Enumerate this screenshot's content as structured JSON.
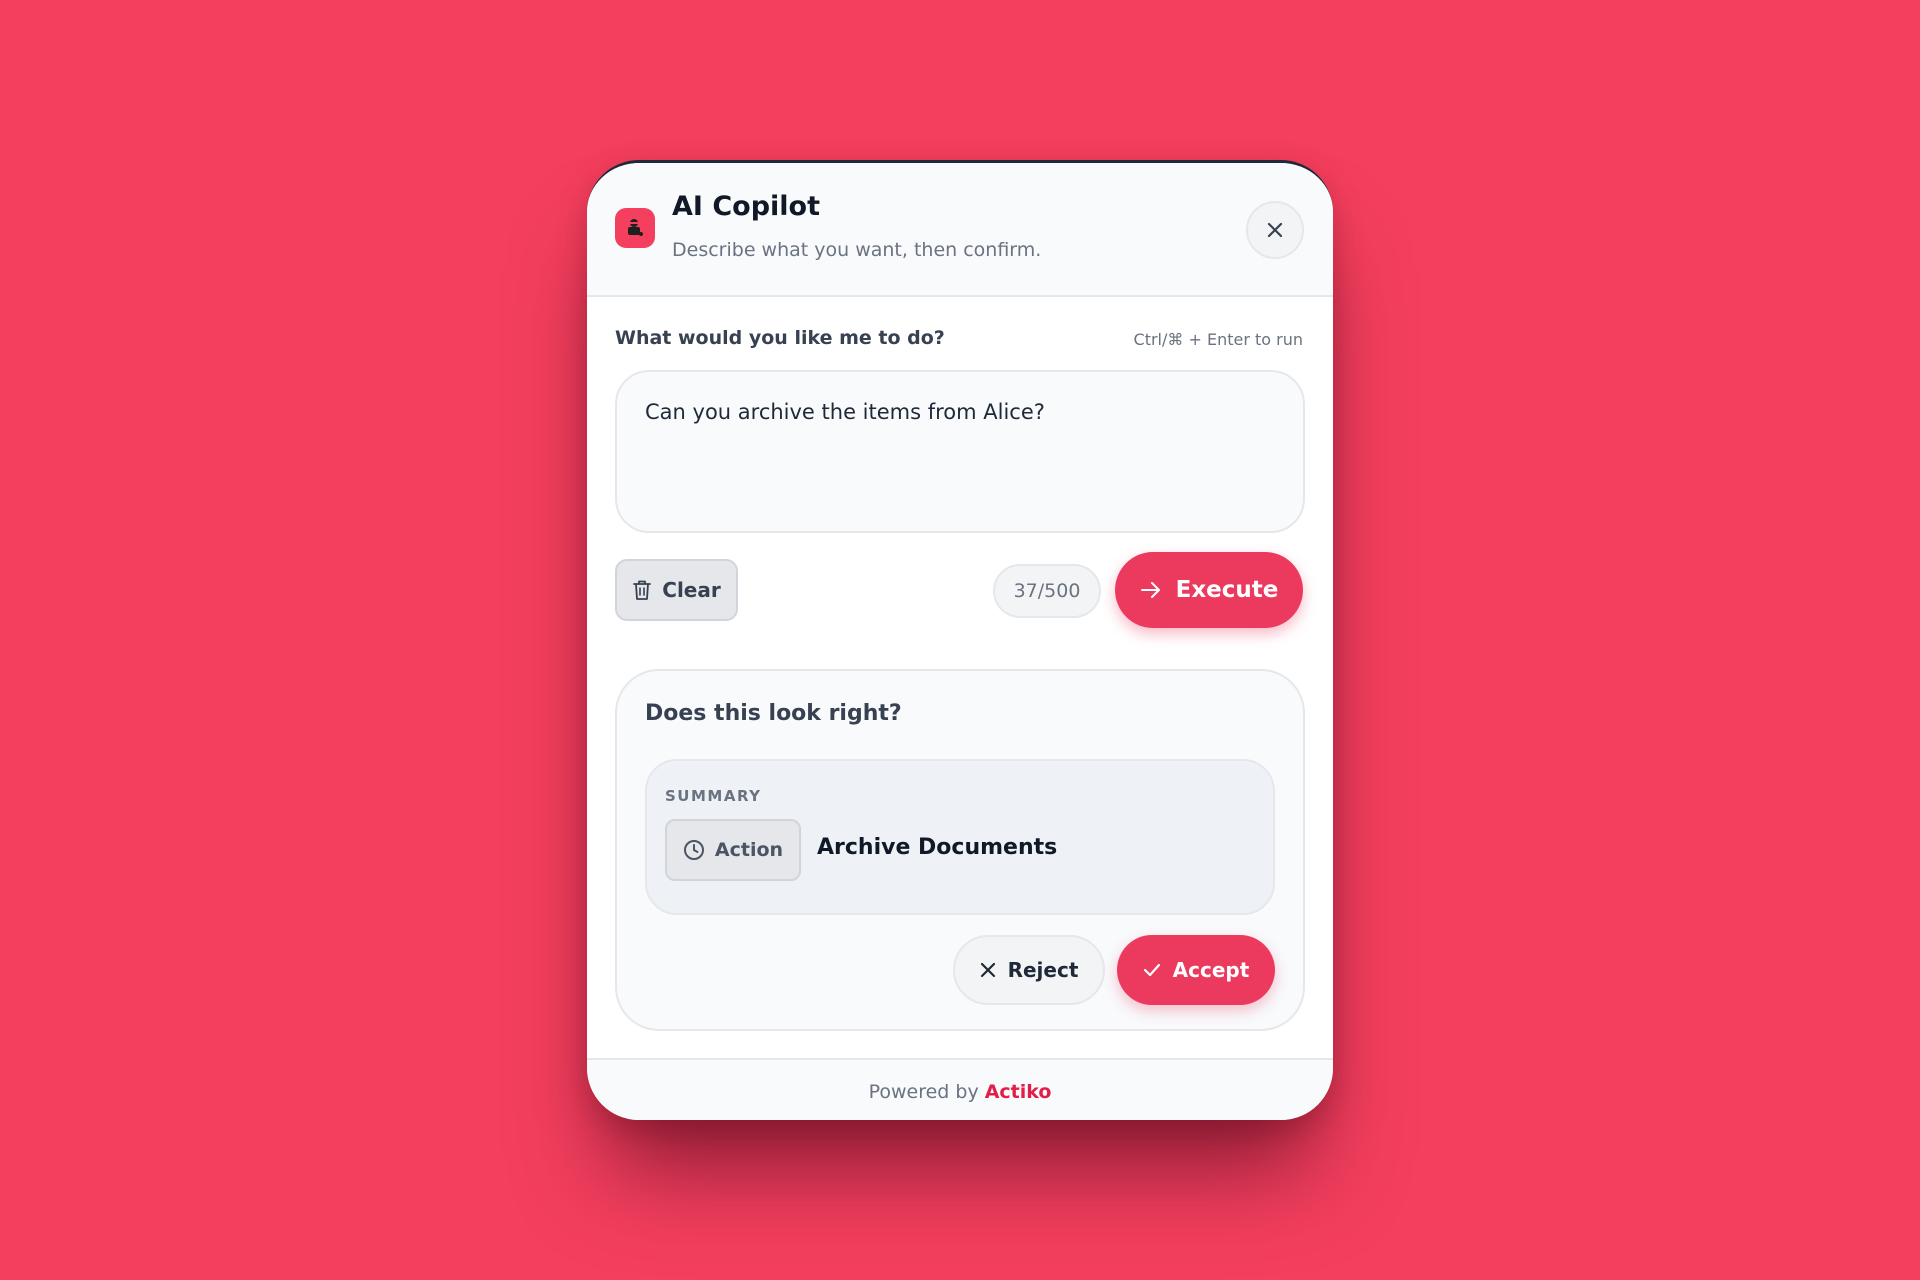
{
  "header": {
    "title": "AI Copilot",
    "subtitle": "Describe what you want, then confirm.",
    "logo_icon": "robot-icon",
    "close_icon": "close-icon"
  },
  "prompt": {
    "label": "What would you like me to do?",
    "hint": "Ctrl/⌘ + Enter to run",
    "value": "Can you archive the items from Alice?",
    "char_count": "37/500"
  },
  "actions": {
    "clear_label": "Clear",
    "clear_icon": "trash-icon",
    "execute_label": "Execute",
    "execute_icon": "arrow-right-icon"
  },
  "confirmation": {
    "title": "Does this look right?",
    "summary_label": "SUMMARY",
    "badge_label": "Action",
    "badge_icon": "clock-icon",
    "action_name": "Archive Documents",
    "reject_label": "Reject",
    "reject_icon": "x-icon",
    "accept_label": "Accept",
    "accept_icon": "check-icon"
  },
  "footer": {
    "powered_by": "Powered by",
    "brand": "Actiko"
  },
  "colors": {
    "background": "#f43f5e",
    "accent": "#ec3a5e",
    "brand": "#e11d48"
  }
}
